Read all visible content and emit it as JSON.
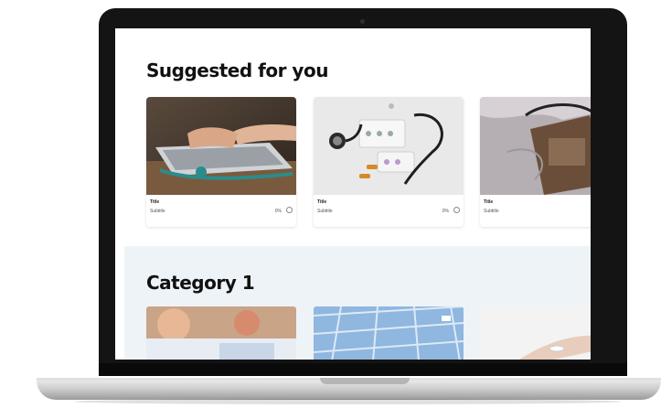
{
  "suggested": {
    "heading": "Suggested for you",
    "cards": [
      {
        "title": "Title",
        "subtitle": "Subtitle",
        "percent": "0%",
        "image": "laptop-stethoscope-photo"
      },
      {
        "title": "Title",
        "subtitle": "Subtitle",
        "percent": "0%",
        "image": "stethoscope-pills-photo"
      },
      {
        "title": "Title",
        "subtitle": "Subtitle",
        "percent": "",
        "image": "stethoscope-clipboard-photo"
      }
    ]
  },
  "category1": {
    "heading": "Category 1",
    "images": [
      "doctor-photo",
      "hospital-ceiling-photo",
      "hand-pill-photo"
    ]
  },
  "colors": {
    "bezel": "#141414",
    "category_bg": "#eef3f7",
    "heading": "#111111"
  }
}
